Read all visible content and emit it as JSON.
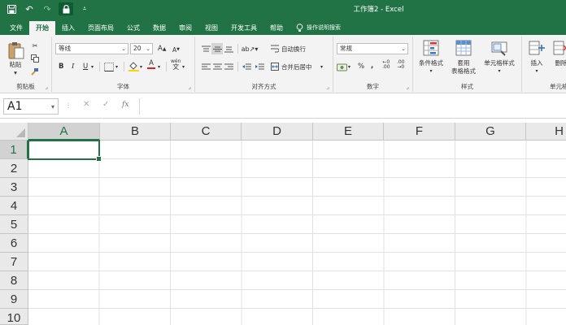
{
  "titlebar": {
    "title": "工作簿2 - Excel",
    "qat": {
      "save_icon": "save-icon",
      "undo_icon": "undo-icon",
      "redo_icon": "redo-icon",
      "lock_icon": "lock-icon",
      "customize_icon": "customize-qat-icon"
    }
  },
  "tabs": [
    {
      "label": "文件"
    },
    {
      "label": "开始"
    },
    {
      "label": "插入"
    },
    {
      "label": "页面布局"
    },
    {
      "label": "公式"
    },
    {
      "label": "数据"
    },
    {
      "label": "审阅"
    },
    {
      "label": "视图"
    },
    {
      "label": "开发工具"
    },
    {
      "label": "帮助"
    }
  ],
  "tell_me": "操作说明搜索",
  "active_tab": "开始",
  "ribbon": {
    "clipboard": {
      "label": "剪贴板",
      "paste": "粘贴"
    },
    "font": {
      "label": "字体",
      "font_name": "等线",
      "font_size": "20",
      "bold": "B",
      "italic": "I",
      "underline": "U",
      "grow": "A",
      "shrink": "A",
      "font_color_letter": "A",
      "phonetic": "wén"
    },
    "alignment": {
      "label": "对齐方式",
      "wrap_text": "自动换行",
      "merge_center": "合并后居中"
    },
    "number": {
      "label": "数字",
      "format": "常规",
      "percent": "%",
      "comma": ",",
      "inc_decimal": ".00",
      "dec_decimal": ".00"
    },
    "styles": {
      "label": "样式",
      "conditional": "条件格式",
      "table_format_line1": "套用",
      "table_format_line2": "表格格式",
      "cell_styles": "单元格样式"
    },
    "cells": {
      "label": "单元格",
      "insert": "插入",
      "delete": "删除"
    }
  },
  "formula_bar": {
    "name_box": "A1",
    "fx": "fx",
    "value": ""
  },
  "grid": {
    "columns": [
      "A",
      "B",
      "C",
      "D",
      "E",
      "F",
      "G",
      "H"
    ],
    "rows": [
      "1",
      "2",
      "3",
      "4",
      "5",
      "6",
      "7",
      "8",
      "9",
      "10"
    ],
    "selected_column": "A",
    "selected_row": "1"
  },
  "colors": {
    "accent": "#217346"
  }
}
